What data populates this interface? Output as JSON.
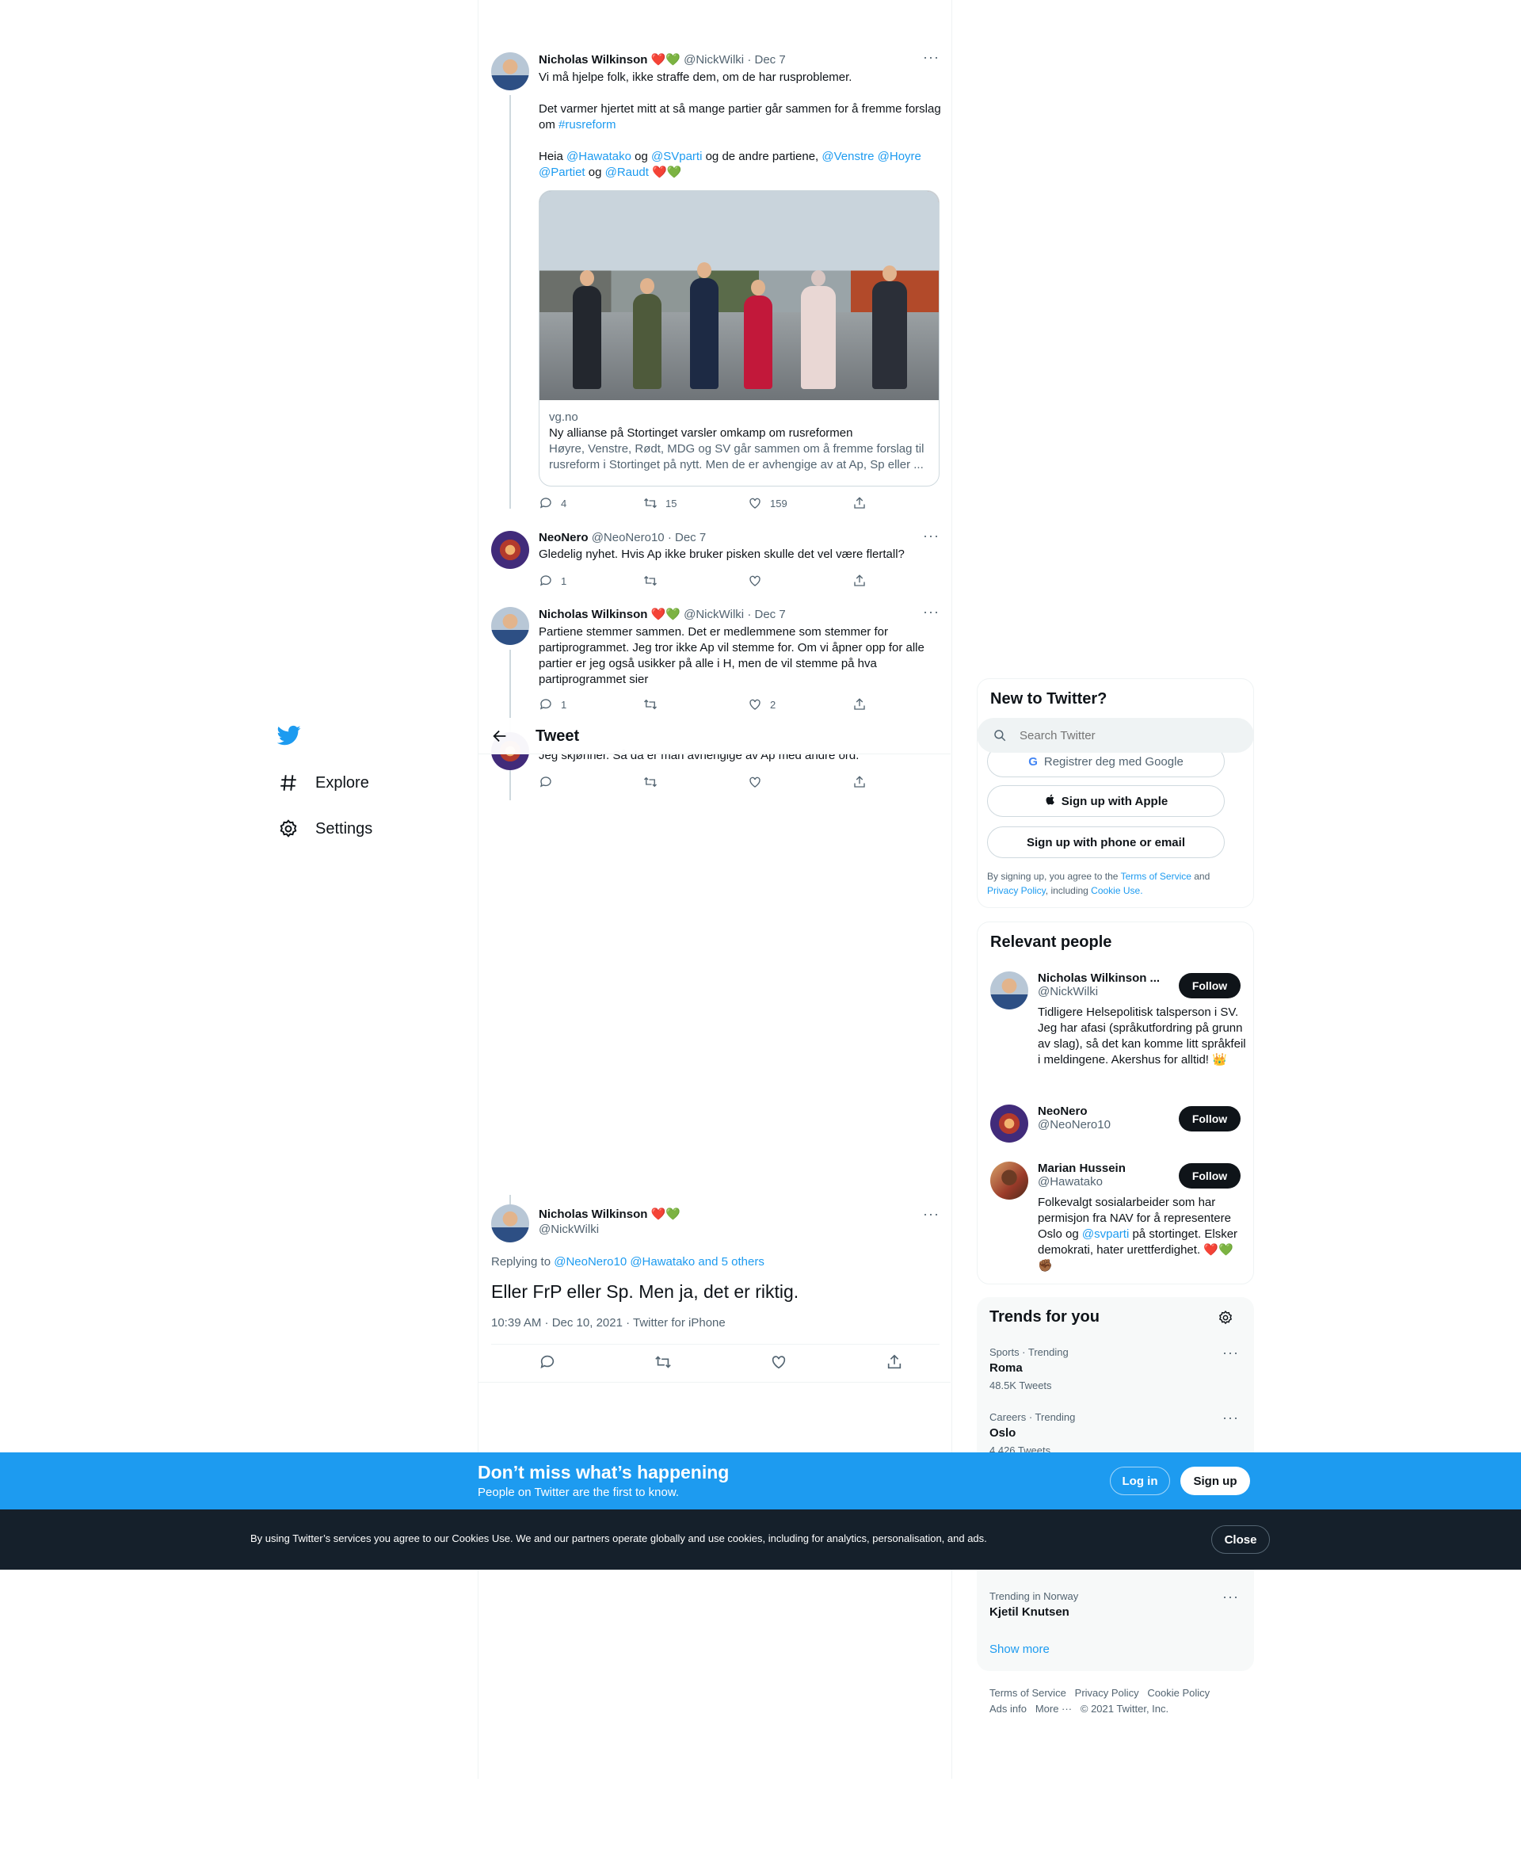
{
  "nav": {
    "explore": "Explore",
    "settings": "Settings"
  },
  "header": {
    "title": "Tweet"
  },
  "tweets": [
    {
      "name": "Nicholas Wilkinson",
      "hearts": "❤️💚",
      "handle": "@NickWilki",
      "dot": "·",
      "date": "Dec 7",
      "line1": "Vi må hjelpe folk, ikke straffe dem, om de har rusproblemer.",
      "line2a": "Det varmer hjertet mitt at så mange partier går sammen for å fremme forslag",
      "line2b": "om ",
      "hashtag": "#rusreform",
      "line3a": "Heia ",
      "m1": "@Hawatako",
      "og1": " og ",
      "m2": "@SVparti",
      "rest1": " og de andre partiene, ",
      "m3": "@Venstre",
      "m4": "@Hoyre",
      "m5": "@Partiet",
      "og2": " og ",
      "m6": "@Raudt",
      "card": {
        "domain": "vg.no",
        "title": "Ny allianse på Stortinget varsler omkamp om rusreformen",
        "desc": "Høyre, Venstre, Rødt, MDG og SV går sammen om å fremme forslag til rusreform i Stortinget på nytt. Men de er avhengige av at Ap, Sp eller ..."
      },
      "replies": "4",
      "retweets": "15",
      "likes": "159"
    },
    {
      "name": "NeoNero",
      "handle": "@NeoNero10",
      "dot": "·",
      "date": "Dec 7",
      "text": "Gledelig nyhet. Hvis Ap ikke bruker pisken skulle det vel være flertall?",
      "replies": "1"
    },
    {
      "name": "Nicholas Wilkinson",
      "hearts": "❤️💚",
      "handle": "@NickWilki",
      "dot": "·",
      "date": "Dec 7",
      "text": "Partiene stemmer sammen. Det er medlemmene som stemmer for partiprogrammet. Jeg tror ikke Ap vil stemme for. Om vi åpner opp for alle partier er jeg også usikker på alle i H, men de vil stemme på hva partiprogrammet sier",
      "replies": "1",
      "likes": "2"
    },
    {
      "partial_text": "Jeg skjønner. Så da er man avhengige av Ap med andre ord."
    }
  ],
  "main_tweet": {
    "name": "Nicholas Wilkinson",
    "hearts": "❤️💚",
    "handle": "@NickWilki",
    "replying_label": "Replying to ",
    "replying_to": "@NeoNero10 @Hawatako and 5 others",
    "text": "Eller FrP eller Sp. Men ja, det er riktig.",
    "meta": "10:39 AM · Dec 10, 2021 · Twitter for iPhone"
  },
  "sidebar": {
    "new_title": "New to Twitter?",
    "search_placeholder": "Search Twitter",
    "google_label": "Registrer deg med Google",
    "apple_label": "Sign up with Apple",
    "phone_label": "Sign up with phone or email",
    "terms_1": "By signing up, you agree to the ",
    "terms_link1": "Terms of Service",
    "terms_2": " and ",
    "terms_link2": "Privacy Policy",
    "terms_3": ", including ",
    "terms_link3": "Cookie Use.",
    "relevant_title": "Relevant people",
    "people": [
      {
        "name": "Nicholas Wilkinson ...",
        "handle": "@NickWilki",
        "bio": "Tidligere Helsepolitisk talsperson i SV. Jeg har afasi (språkutfordring på grunn av slag), så det kan komme litt språkfeil i meldingene. Akershus for alltid! 👑",
        "follow": "Follow"
      },
      {
        "name": "NeoNero",
        "handle": "@NeoNero10",
        "follow": "Follow"
      },
      {
        "name": "Marian Hussein",
        "handle": "@Hawatako",
        "bio_a": "Folkevalgt sosialarbeider som har permisjon fra NAV for å representere Oslo og ",
        "bio_link": "@svparti",
        "bio_b": " på stortinget. Elsker demokrati, hater urettferdighet. ❤️💚 ✊🏾",
        "follow": "Follow"
      }
    ],
    "trends_title": "Trends for you",
    "trends": [
      {
        "meta": "Sports · Trending",
        "name": "Roma",
        "count": "48.5K Tweets"
      },
      {
        "meta": "Careers · Trending",
        "name": "Oslo",
        "count": "4,426 Tweets"
      },
      {
        "meta": "Trending in Norway",
        "name": "Kjetil Knutsen"
      }
    ],
    "show_more": "Show more",
    "footer": {
      "tos": "Terms of Service",
      "privacy": "Privacy Policy",
      "cookie": "Cookie Policy",
      "ads": "Ads info",
      "more": "More ···",
      "copyright": "© 2021 Twitter, Inc."
    }
  },
  "banner": {
    "title": "Don’t miss what’s happening",
    "subtitle": "People on Twitter are the first to know.",
    "login": "Log in",
    "signup": "Sign up"
  },
  "cookie": {
    "text": "By using Twitter’s services you agree to our Cookies Use. We and our partners operate globally and use cookies, including for analytics, personalisation, and ads.",
    "close": "Close"
  },
  "colors": {
    "accent": "#1d9bf0",
    "dark": "#0f1419",
    "muted": "#536471",
    "banner": "#1d9bf0",
    "cookie_bg": "#15202b"
  }
}
